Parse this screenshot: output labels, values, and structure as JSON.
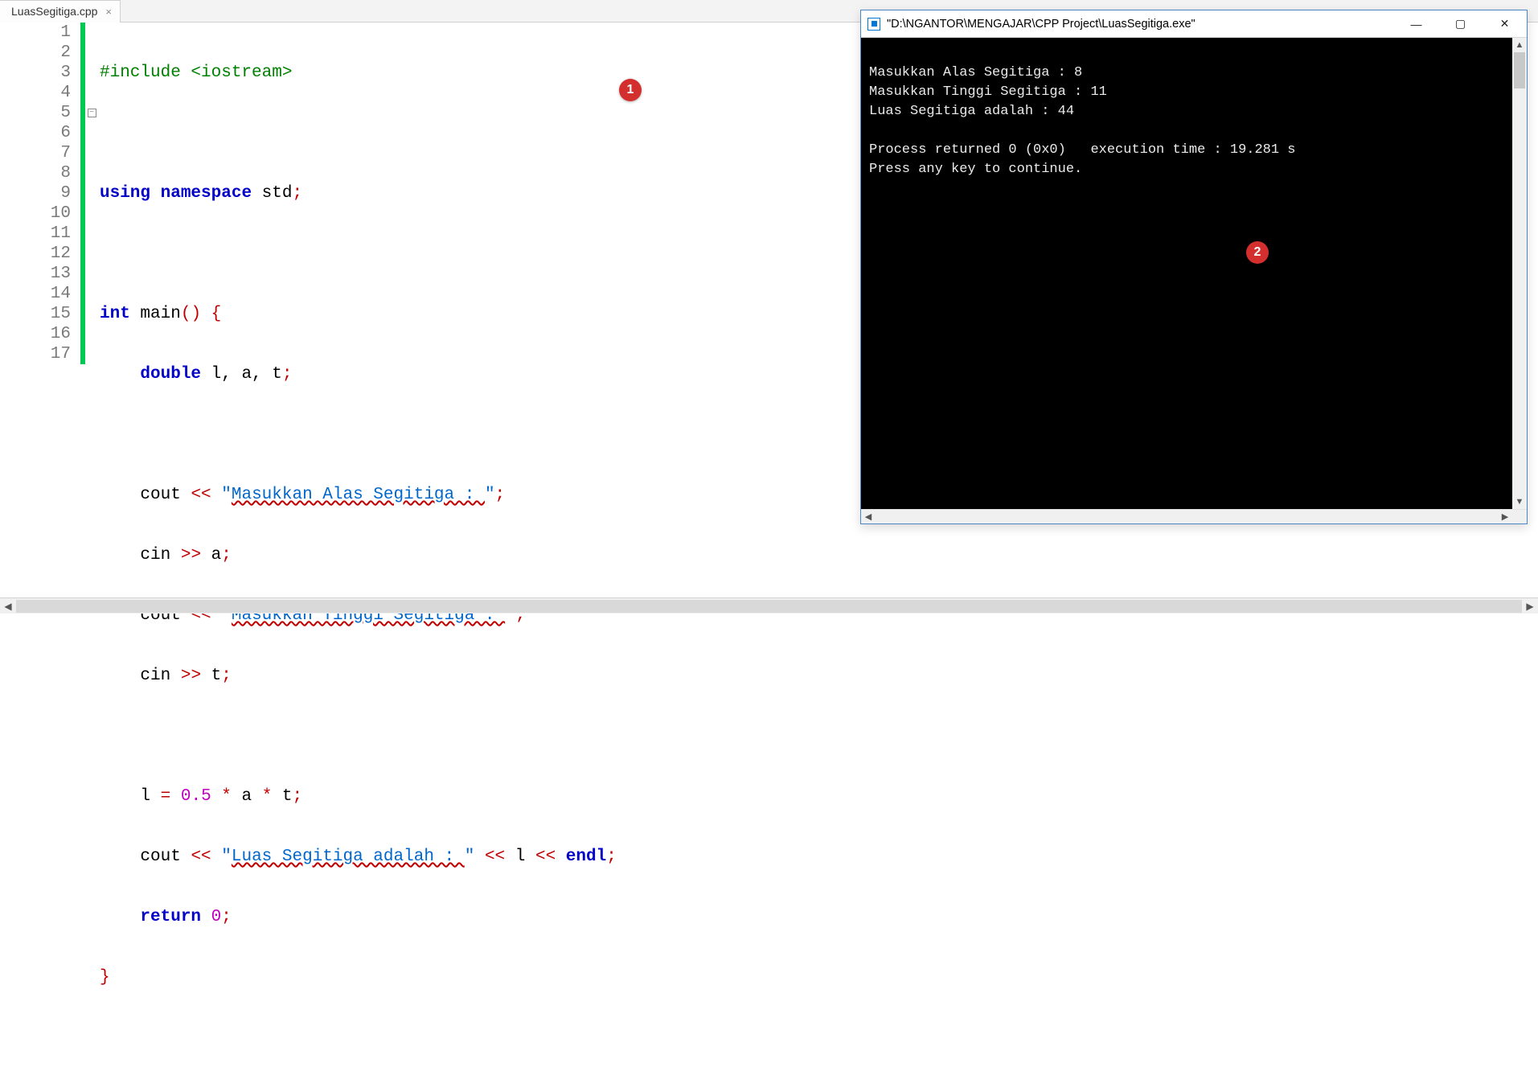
{
  "tab": {
    "filename": "LuasSegitiga.cpp",
    "close_glyph": "×"
  },
  "badges": {
    "one": "1",
    "two": "2"
  },
  "console": {
    "title": "\"D:\\NGANTOR\\MENGAJAR\\CPP Project\\LuasSegitiga.exe\"",
    "lines": [
      "Masukkan Alas Segitiga : 8",
      "Masukkan Tinggi Segitiga : 11",
      "Luas Segitiga adalah : 44",
      "",
      "Process returned 0 (0x0)   execution time : 19.281 s",
      "Press any key to continue."
    ],
    "btn_min": "—",
    "btn_max": "▢",
    "btn_close": "✕"
  },
  "code": {
    "lines": {
      "1": {
        "pre": "#include <iostream>"
      },
      "2": {
        "raw": ""
      },
      "3": {
        "kw1": "using",
        "kw2": "namespace",
        "id": "std",
        "sc": ";"
      },
      "4": {
        "raw": ""
      },
      "5": {
        "kw1": "int",
        "id": "main",
        "paren": "()",
        "brace": " {"
      },
      "6": {
        "indent": "    ",
        "kw": "double",
        "rest": " l, a, t",
        "sc": ";"
      },
      "7": {
        "raw": ""
      },
      "8": {
        "indent": "    ",
        "id": "cout ",
        "op": "<<",
        "sp": " ",
        "q": "\"",
        "str": "Masukkan Alas Segitiga : ",
        "sc": ";"
      },
      "9": {
        "indent": "    ",
        "id": "cin ",
        "op": ">>",
        "rest": " a",
        "sc": ";"
      },
      "10": {
        "indent": "    ",
        "id": "cout ",
        "op": "<<",
        "sp": " ",
        "q": "\"",
        "str": "Masukkan Tinggi Segitiga : ",
        "sc": ";"
      },
      "11": {
        "indent": "    ",
        "id": "cin ",
        "op": ">>",
        "rest": " t",
        "sc": ";"
      },
      "12": {
        "raw": ""
      },
      "13": {
        "indent": "    ",
        "lhs": "l ",
        "eq": "=",
        "sp": " ",
        "num": "0.5",
        "mul": " * ",
        "a": "a",
        "mul2": " * ",
        "t": "t",
        "sc": ";"
      },
      "14": {
        "indent": "    ",
        "id": "cout ",
        "op": "<<",
        "sp": " ",
        "q": "\"",
        "str": "Luas Segitiga adalah : ",
        "op2": " << ",
        "var": "l",
        "op3": " << ",
        "endl": "endl",
        "sc": ";"
      },
      "15": {
        "indent": "    ",
        "kw": "return",
        "sp": " ",
        "num": "0",
        "sc": ";"
      },
      "16": {
        "brace": "}"
      },
      "17": {
        "raw": ""
      }
    },
    "line_numbers": [
      "1",
      "2",
      "3",
      "4",
      "5",
      "6",
      "7",
      "8",
      "9",
      "10",
      "11",
      "12",
      "13",
      "14",
      "15",
      "16",
      "17"
    ]
  }
}
